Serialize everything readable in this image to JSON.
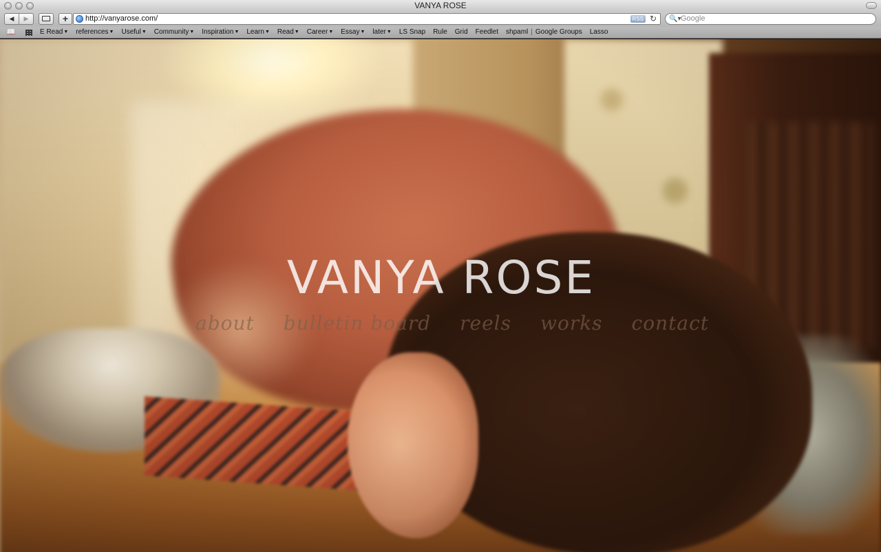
{
  "window": {
    "title": "VANYA ROSE"
  },
  "toolbar": {
    "back_glyph": "◀",
    "forward_glyph": "▶",
    "add_glyph": "+",
    "url": "http://vanyarose.com/",
    "rss_label": "RSS",
    "reload_glyph": "↻",
    "search_placeholder": "Google",
    "search_glyph": "🔍▾"
  },
  "bookmarks": [
    {
      "label": "E Read",
      "dropdown": true
    },
    {
      "label": "references",
      "dropdown": true
    },
    {
      "label": "Useful",
      "dropdown": true
    },
    {
      "label": "Community",
      "dropdown": true
    },
    {
      "label": "Inspiration",
      "dropdown": true
    },
    {
      "label": "Learn",
      "dropdown": true
    },
    {
      "label": "Read",
      "dropdown": true
    },
    {
      "label": "Career",
      "dropdown": true
    },
    {
      "label": "Essay",
      "dropdown": true
    },
    {
      "label": "later",
      "dropdown": true
    },
    {
      "label": "LS Snap",
      "dropdown": false
    },
    {
      "label": "Rule",
      "dropdown": false
    },
    {
      "label": "Grid",
      "dropdown": false
    },
    {
      "label": "Feedlet",
      "dropdown": false
    },
    {
      "label": "shpaml",
      "dropdown": false
    },
    {
      "label": "Google Groups",
      "dropdown": false
    },
    {
      "label": "Lasso",
      "dropdown": false
    }
  ],
  "bookmark_icons": {
    "book": "📖",
    "grid": "grid-icon"
  },
  "page": {
    "title": "VANYA ROSE",
    "nav": [
      "about",
      "bulletin board",
      "reels",
      "works",
      "contact"
    ]
  }
}
